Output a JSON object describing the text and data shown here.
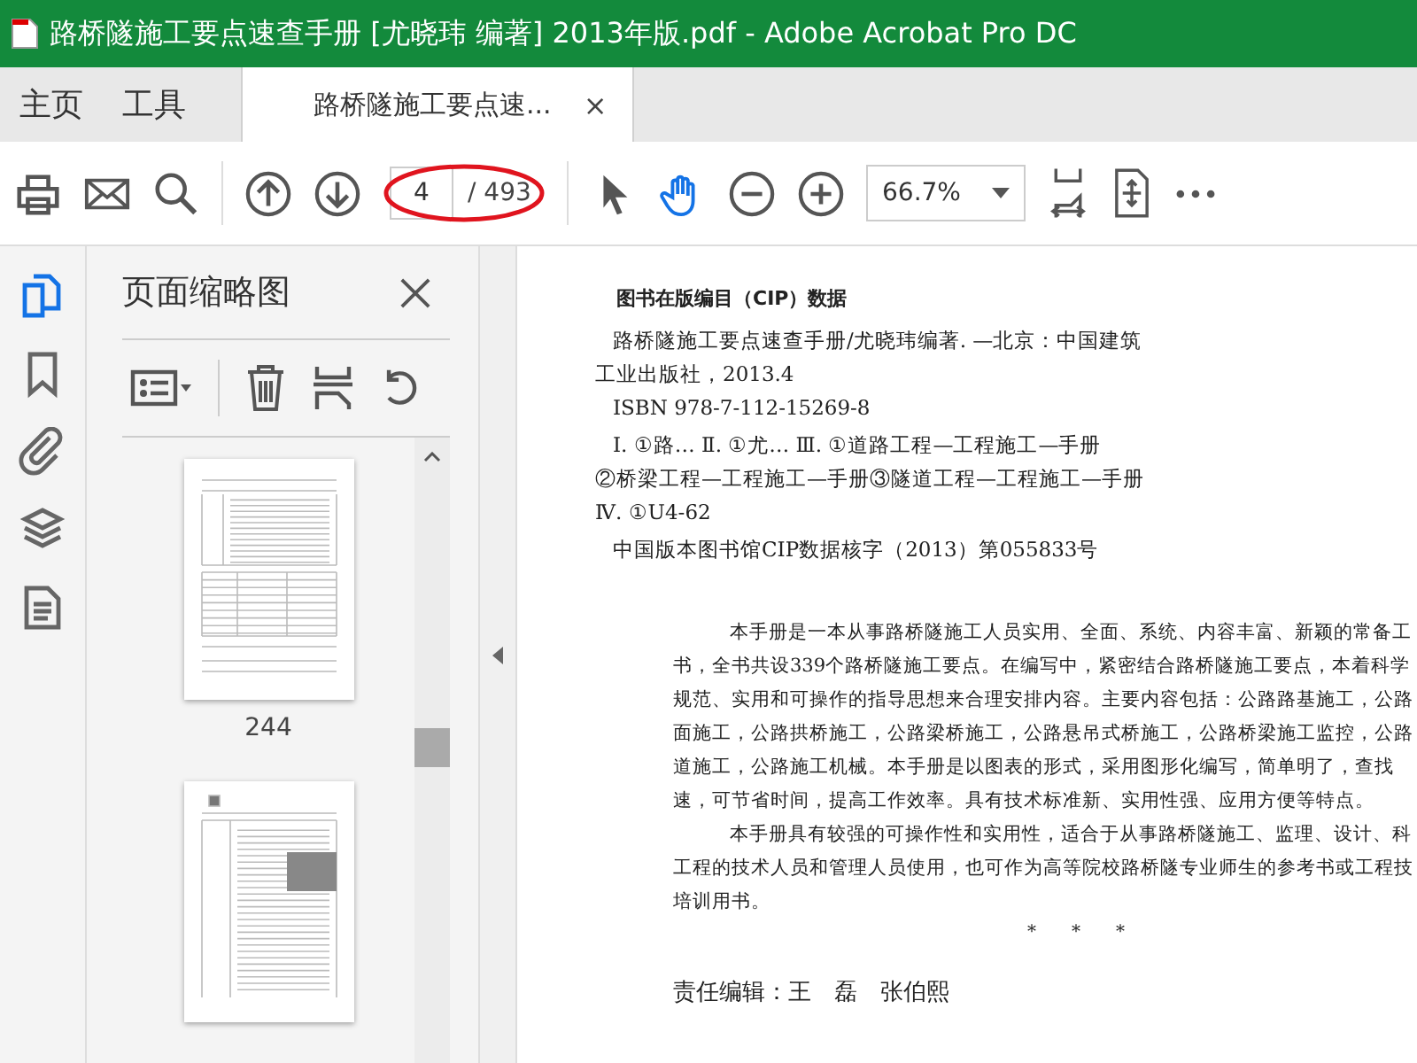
{
  "window": {
    "title": "路桥隧施工要点速查手册 [尤晓玮 编著] 2013年版.pdf - Adobe Acrobat Pro DC"
  },
  "tabs": [
    {
      "label": "主页",
      "selected": false,
      "closable": false
    },
    {
      "label": "工具",
      "selected": false,
      "closable": false
    },
    {
      "label": "路桥隧施工要点速...",
      "selected": true,
      "closable": true
    }
  ],
  "tab_close": "×",
  "toolbar": {
    "page_number": "4",
    "page_total": "/ 493",
    "zoom": "66.7%",
    "tools": [
      {
        "kind": "select",
        "selected": false
      },
      {
        "kind": "hand",
        "selected": true
      }
    ]
  },
  "nav_rail": [
    {
      "kind": "pages",
      "selected": true
    },
    {
      "kind": "bookmarks",
      "selected": false
    },
    {
      "kind": "attachments",
      "selected": false
    },
    {
      "kind": "layers",
      "selected": false
    },
    {
      "kind": "document",
      "selected": false
    }
  ],
  "thumbnails_panel": {
    "title": "页面缩略图",
    "thumbnails": [
      {
        "kind": "table",
        "label": "244"
      },
      {
        "kind": "photo"
      }
    ]
  },
  "document": {
    "cip_heading": "图书在版编目（CIP）数据",
    "cip_paragraphs": [
      [
        {
          "text": "路桥隧施工要点速查手册/尤晓玮编著. —北京：中国建筑",
          "indent": true
        },
        {
          "text": "工业出版社，2013.4",
          "indent": false
        },
        {
          "text": "ISBN 978-7-112-15269-8",
          "indent": true
        }
      ],
      [
        {
          "text": "Ⅰ. ①路… Ⅱ. ①尤… Ⅲ. ①道路工程—工程施工—手册",
          "indent": true
        },
        {
          "text": "②桥梁工程—工程施工—手册③隧道工程—工程施工—手册",
          "indent": false
        },
        {
          "text": "Ⅳ. ①U4-62",
          "indent": false
        }
      ],
      [
        {
          "text": "中国版本图书馆CIP数据核字（2013）第055833号",
          "indent": true
        }
      ]
    ],
    "body_paragraphs": [
      [
        {
          "text": "本手册是一本从事路桥隧施工人员实用、全面、系统、内容丰富、新颖的常备工",
          "indent": true
        },
        {
          "text": "书，全书共设339个路桥隧施工要点。在编写中，紧密结合路桥隧施工要点，本着科学",
          "indent": false
        },
        {
          "text": "规范、实用和可操作的指导思想来合理安排内容。主要内容包括：公路路基施工，公路",
          "indent": false
        },
        {
          "text": "面施工，公路拱桥施工，公路梁桥施工，公路悬吊式桥施工，公路桥梁施工监控，公路",
          "indent": false
        },
        {
          "text": "道施工，公路施工机械。本手册是以图表的形式，采用图形化编写，简单明了，查找",
          "indent": false
        },
        {
          "text": "速，可节省时间，提高工作效率。具有技术标准新、实用性强、应用方便等特点。",
          "indent": false
        }
      ],
      [
        {
          "text": "本手册具有较强的可操作性和实用性，适合于从事路桥隧施工、监理、设计、科",
          "indent": true
        },
        {
          "text": "工程的技术人员和管理人员使用，也可作为高等院校路桥隧专业师生的参考书或工程技",
          "indent": false
        },
        {
          "text": "培训用书。",
          "indent": false
        }
      ]
    ],
    "separator": "*　　*　　*",
    "credits": "责任编辑：王　磊　张伯熙"
  }
}
